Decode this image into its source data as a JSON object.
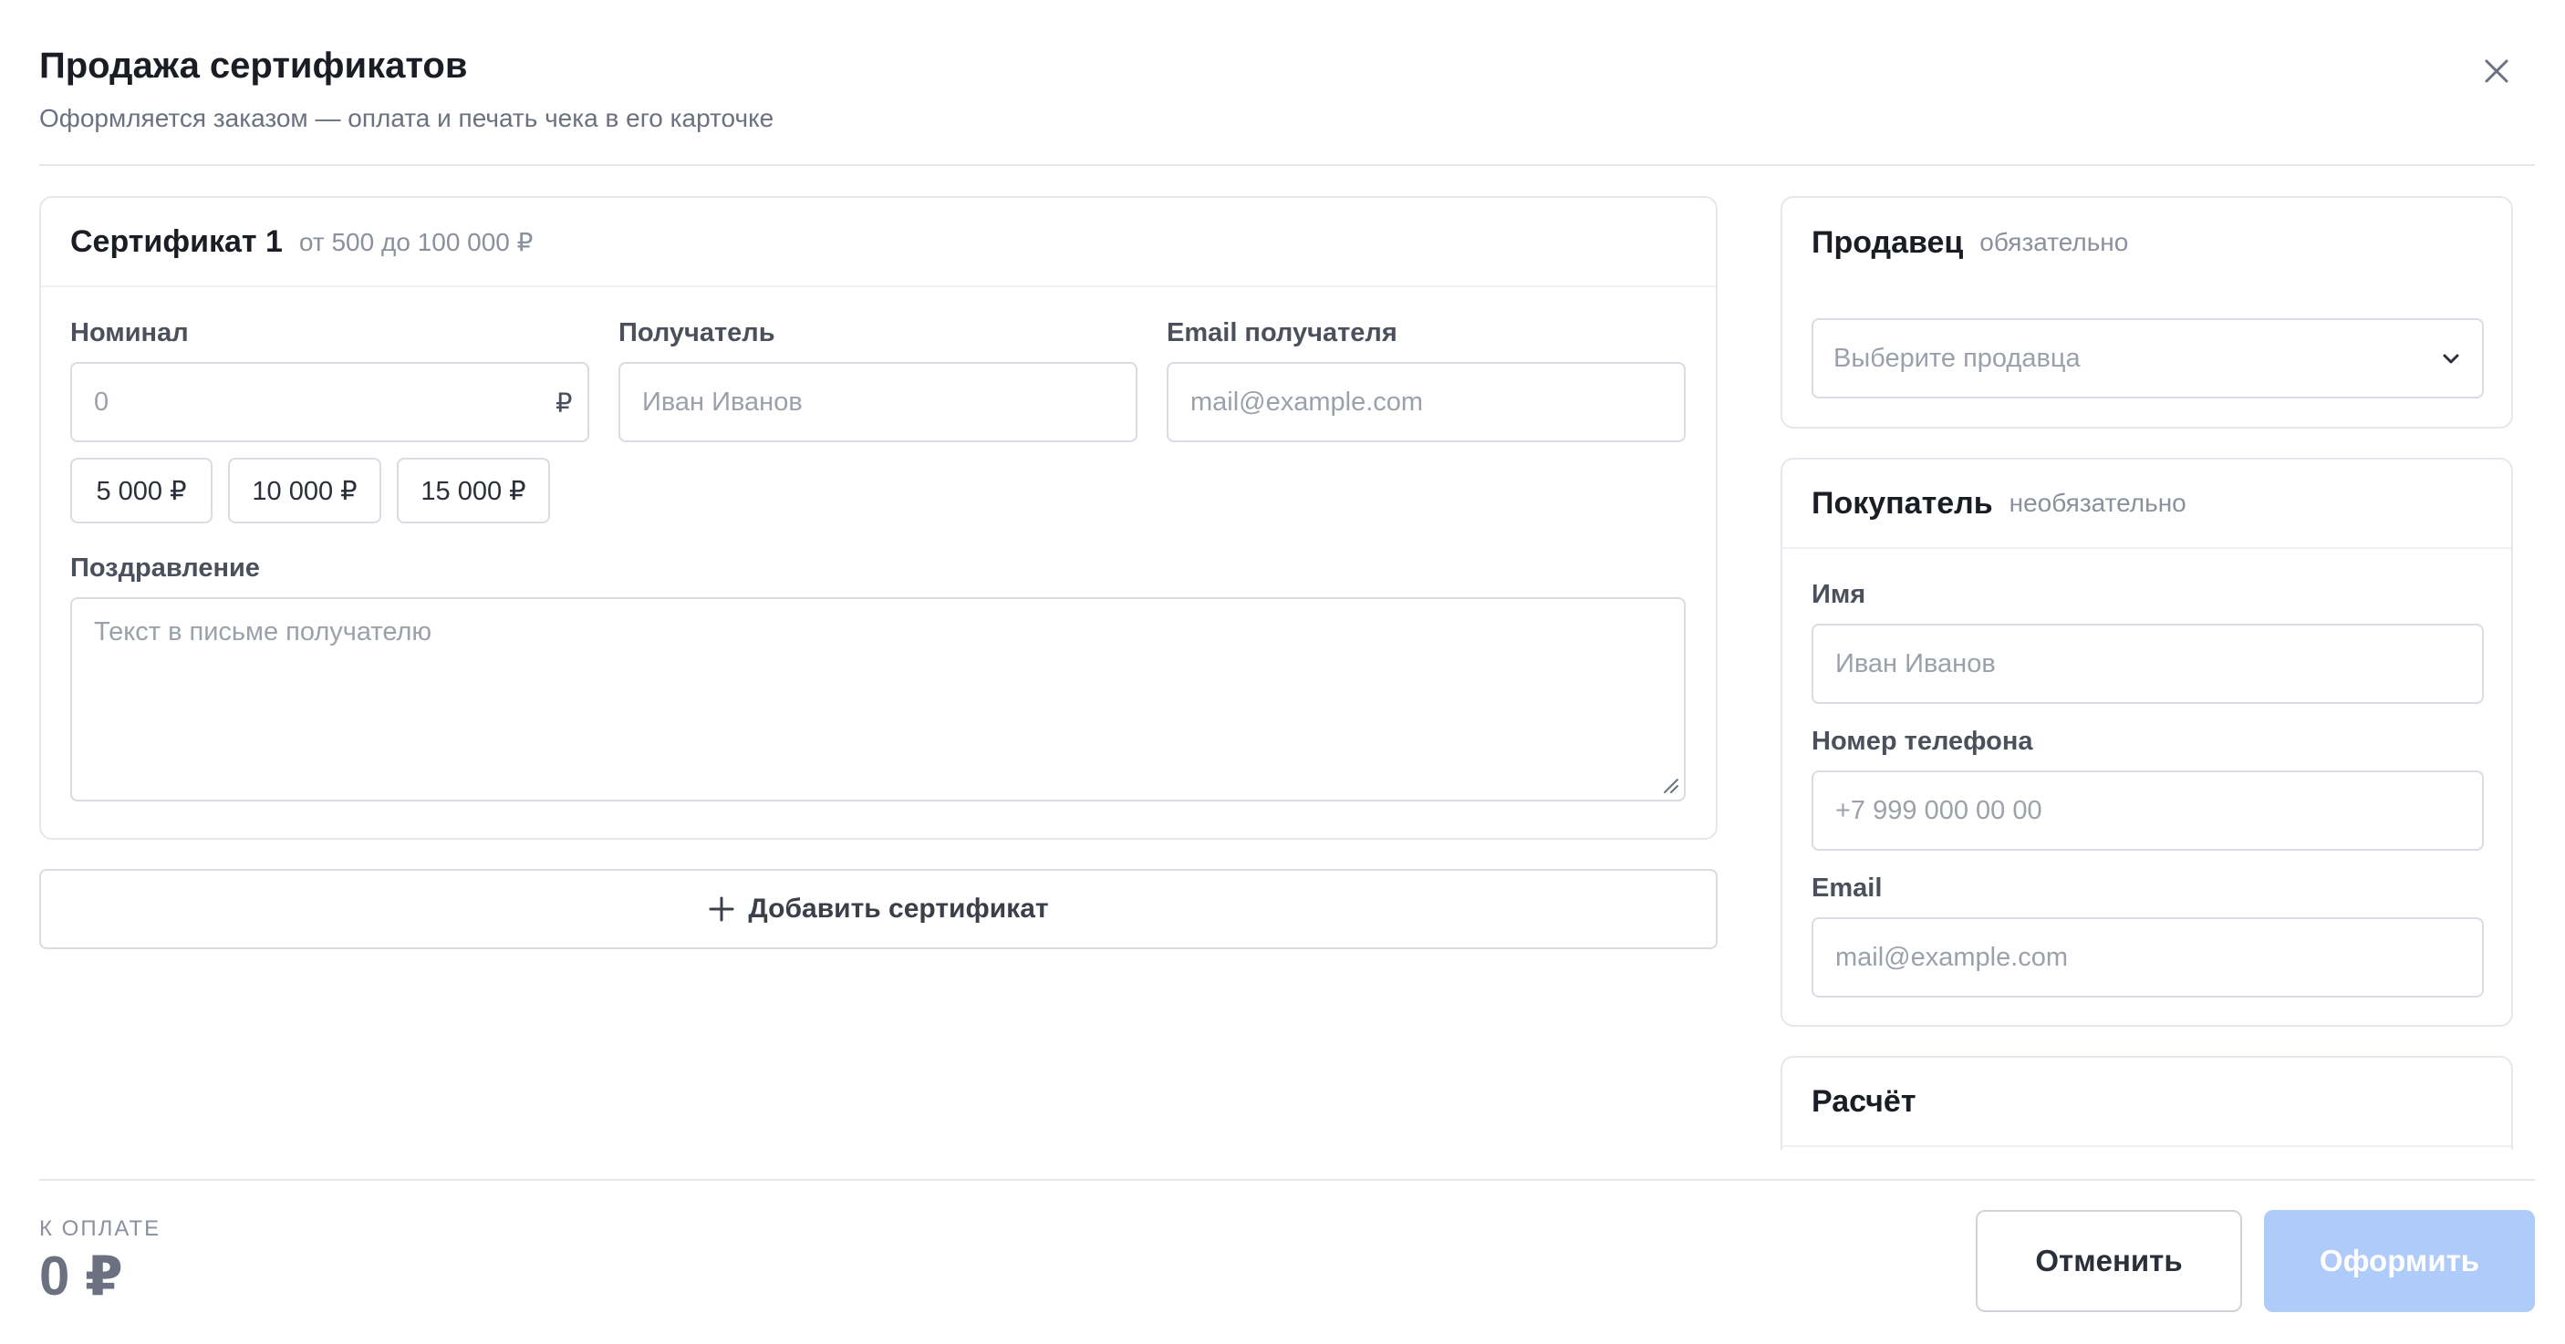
{
  "dialog": {
    "title": "Продажа сертификатов",
    "subtitle": "Оформляется заказом — оплата и печать чека в его карточке"
  },
  "certificate": {
    "title": "Сертификат 1",
    "range_hint": "от 500 до 100 000 ₽",
    "nominal": {
      "label": "Номинал",
      "value": "",
      "placeholder": "0",
      "suffix": "₽"
    },
    "presets": [
      "5 000 ₽",
      "10 000 ₽",
      "15 000 ₽"
    ],
    "recipient": {
      "label": "Получатель",
      "value": "",
      "placeholder": "Иван Иванов"
    },
    "recipient_email": {
      "label": "Email получателя",
      "value": "",
      "placeholder": "mail@example.com"
    },
    "greeting": {
      "label": "Поздравление",
      "value": "",
      "placeholder": "Текст в письме получателю"
    }
  },
  "add_certificate": {
    "label": "Добавить сертификат"
  },
  "seller": {
    "title": "Продавец",
    "hint": "обязательно",
    "select_placeholder": "Выберите продавца"
  },
  "buyer": {
    "title": "Покупатель",
    "hint": "необязательно",
    "name": {
      "label": "Имя",
      "value": "",
      "placeholder": "Иван Иванов"
    },
    "phone": {
      "label": "Номер телефона",
      "value": "",
      "placeholder": "+7 999 000 00 00"
    },
    "email": {
      "label": "Email",
      "value": "",
      "placeholder": "mail@example.com"
    }
  },
  "calculation": {
    "title": "Расчёт"
  },
  "footer": {
    "pay_label": "К ОПЛАТЕ",
    "pay_amount": "0 ₽",
    "cancel_label": "Отменить",
    "submit_label": "Оформить"
  },
  "colors": {
    "primary_disabled": "#aecbfa",
    "border": "#d9dce2",
    "text_muted": "#8b919c"
  },
  "icons": {
    "close": "close-icon",
    "add": "plus-icon",
    "dropdown": "chevron-down-icon",
    "resize": "resize-grip-icon"
  }
}
